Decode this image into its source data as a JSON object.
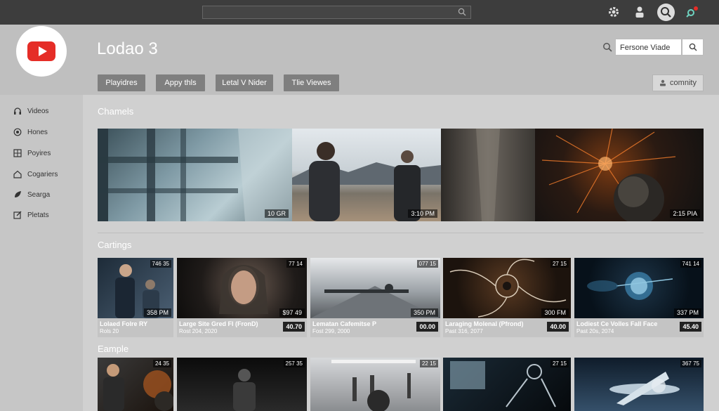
{
  "topbar": {
    "search_placeholder": "",
    "icons": [
      "search-icon",
      "settings-icon",
      "user-icon",
      "notification-icon"
    ]
  },
  "header": {
    "channel_name": "Lodao 3",
    "search_value": "Fersone Viade",
    "tabs": [
      "Playidres",
      "Appy thls",
      "Letal V Nider",
      "Tlie Viewes"
    ],
    "community_label": "comnity",
    "colors": {
      "logo_red": "#e52d27",
      "topbar": "#3d3d3d",
      "pill": "#7f7f7f"
    }
  },
  "sidebar": {
    "items": [
      {
        "label": "Videos",
        "icon": "headphones-icon"
      },
      {
        "label": "Hones",
        "icon": "radio-icon"
      },
      {
        "label": "Poyires",
        "icon": "grid-icon"
      },
      {
        "label": "Cogariers",
        "icon": "home-icon"
      },
      {
        "label": "Searga",
        "icon": "leaf-icon"
      },
      {
        "label": "Pletats",
        "icon": "edit-icon"
      }
    ]
  },
  "sections": {
    "channels": {
      "label": "Chamels",
      "banners": [
        {
          "duration": "10 GR"
        },
        {
          "duration": "3:10 PM"
        },
        {
          "duration": ""
        },
        {
          "duration": "2:15 PIA"
        }
      ]
    },
    "castings": {
      "label": "Cartings",
      "cards": [
        {
          "badge": "746 35",
          "duration": "358 PM",
          "title": "Lolaed Folre RY",
          "meta": "Rols 20",
          "price": ""
        },
        {
          "badge": "77 14",
          "duration": "$97 49",
          "title": "Large Site Gred FI (FronD)",
          "meta": "Rost 204, 2020",
          "price": "40.70"
        },
        {
          "badge": "077 15",
          "duration": "350 PM",
          "title": "Lematan Cafemitse P",
          "meta": "Fost 299, 2000",
          "price": "00.00"
        },
        {
          "badge": "27 15",
          "duration": "300 FM",
          "title": "Laraging Molenal (Pfrond)",
          "meta": "Past 316, 2077",
          "price": "40.00"
        },
        {
          "badge": "741 14",
          "duration": "337 PM",
          "title": "Lodiest Ce Volles Fall Face",
          "meta": "Past 20s, 2074",
          "price": "45.40"
        }
      ]
    },
    "example": {
      "label": "Eample",
      "cards": [
        {
          "badge": "24 35"
        },
        {
          "badge": "257 35"
        },
        {
          "badge": "22 15"
        },
        {
          "badge": "27 15"
        },
        {
          "badge": "367 75"
        }
      ]
    }
  }
}
